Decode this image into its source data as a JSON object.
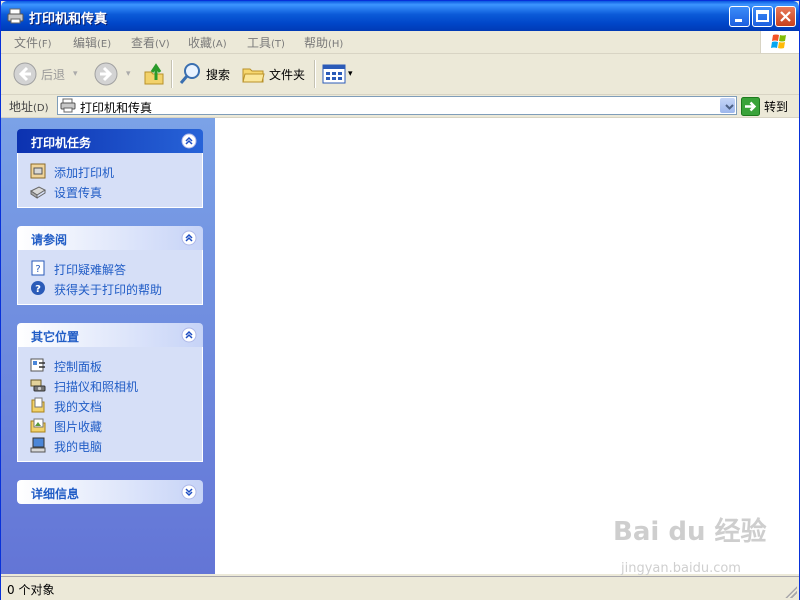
{
  "window": {
    "title": "打印机和传真",
    "buttons": {
      "minimize": "minimize",
      "maximize": "maximize",
      "close": "close"
    }
  },
  "menu": [
    {
      "label": "文件",
      "accel": "(F)"
    },
    {
      "label": "编辑",
      "accel": "(E)"
    },
    {
      "label": "查看",
      "accel": "(V)"
    },
    {
      "label": "收藏",
      "accel": "(A)"
    },
    {
      "label": "工具",
      "accel": "(T)"
    },
    {
      "label": "帮助",
      "accel": "(H)"
    }
  ],
  "toolbar": {
    "back_label": "后退",
    "search_label": "搜索",
    "folders_label": "文件夹"
  },
  "address": {
    "label": "地址",
    "accel": "(D)",
    "value": "打印机和传真",
    "go_label": "转到"
  },
  "taskpane": {
    "printer_tasks": {
      "title": "打印机任务",
      "items": [
        "添加打印机",
        "设置传真"
      ]
    },
    "see_also": {
      "title": "请参阅",
      "items": [
        "打印疑难解答",
        "获得关于打印的帮助"
      ]
    },
    "other_places": {
      "title": "其它位置",
      "items": [
        "控制面板",
        "扫描仪和照相机",
        "我的文档",
        "图片收藏",
        "我的电脑"
      ]
    },
    "details": {
      "title": "详细信息"
    }
  },
  "status": {
    "text": "0 个对象"
  },
  "watermark": {
    "main": "Bai du 经验",
    "sub": "jingyan.baidu.com"
  },
  "colors": {
    "title_bar": "#0b5ad8",
    "task_pane": "#7ba2e7",
    "link": "#215dc6"
  }
}
